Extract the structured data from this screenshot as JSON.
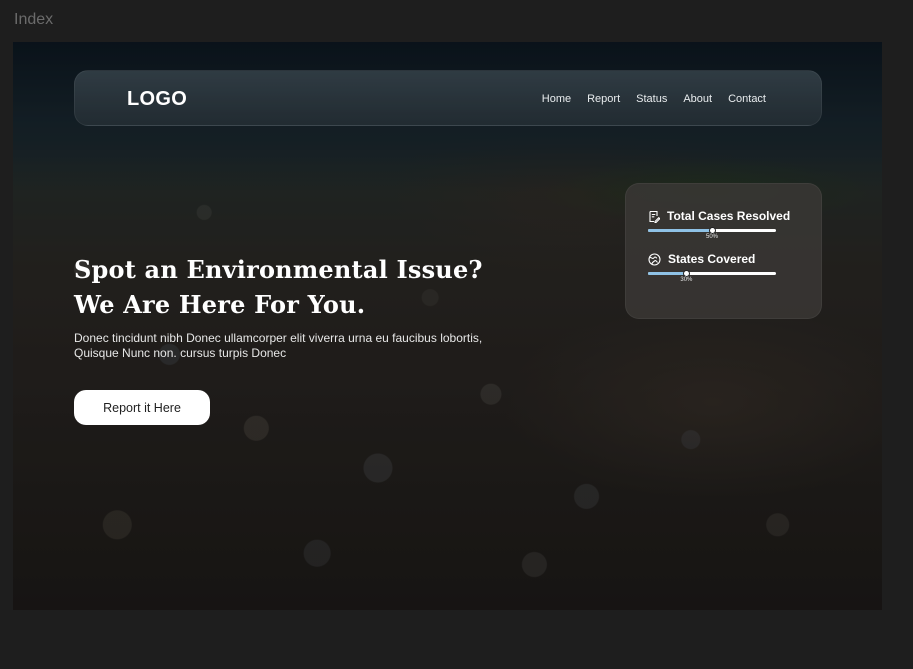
{
  "frame": {
    "label": "Index"
  },
  "nav": {
    "logo": "LOGO",
    "links": [
      "Home",
      "Report",
      "Status",
      "About",
      "Contact"
    ]
  },
  "hero": {
    "headline_line1": "Spot an Environmental Issue?",
    "headline_line2": "We Are Here For You.",
    "subtext_line1": "Donec tincidunt nibh Donec ullamcorper elit viverra urna eu faucibus lobortis,",
    "subtext_line2": "Quisque Nunc non. cursus turpis Donec",
    "cta_label": "Report it Here"
  },
  "stats": [
    {
      "title": "Total Cases Resolved",
      "icon": "note-edit-icon",
      "progress": 0.5,
      "label": "50%"
    },
    {
      "title": "States Covered",
      "icon": "globe-icon",
      "progress": 0.3,
      "label": "30%"
    }
  ],
  "colors": {
    "page_bg": "#1e1e1e",
    "progress_fill": "#8fc2e6",
    "cta_bg": "#ffffff"
  }
}
